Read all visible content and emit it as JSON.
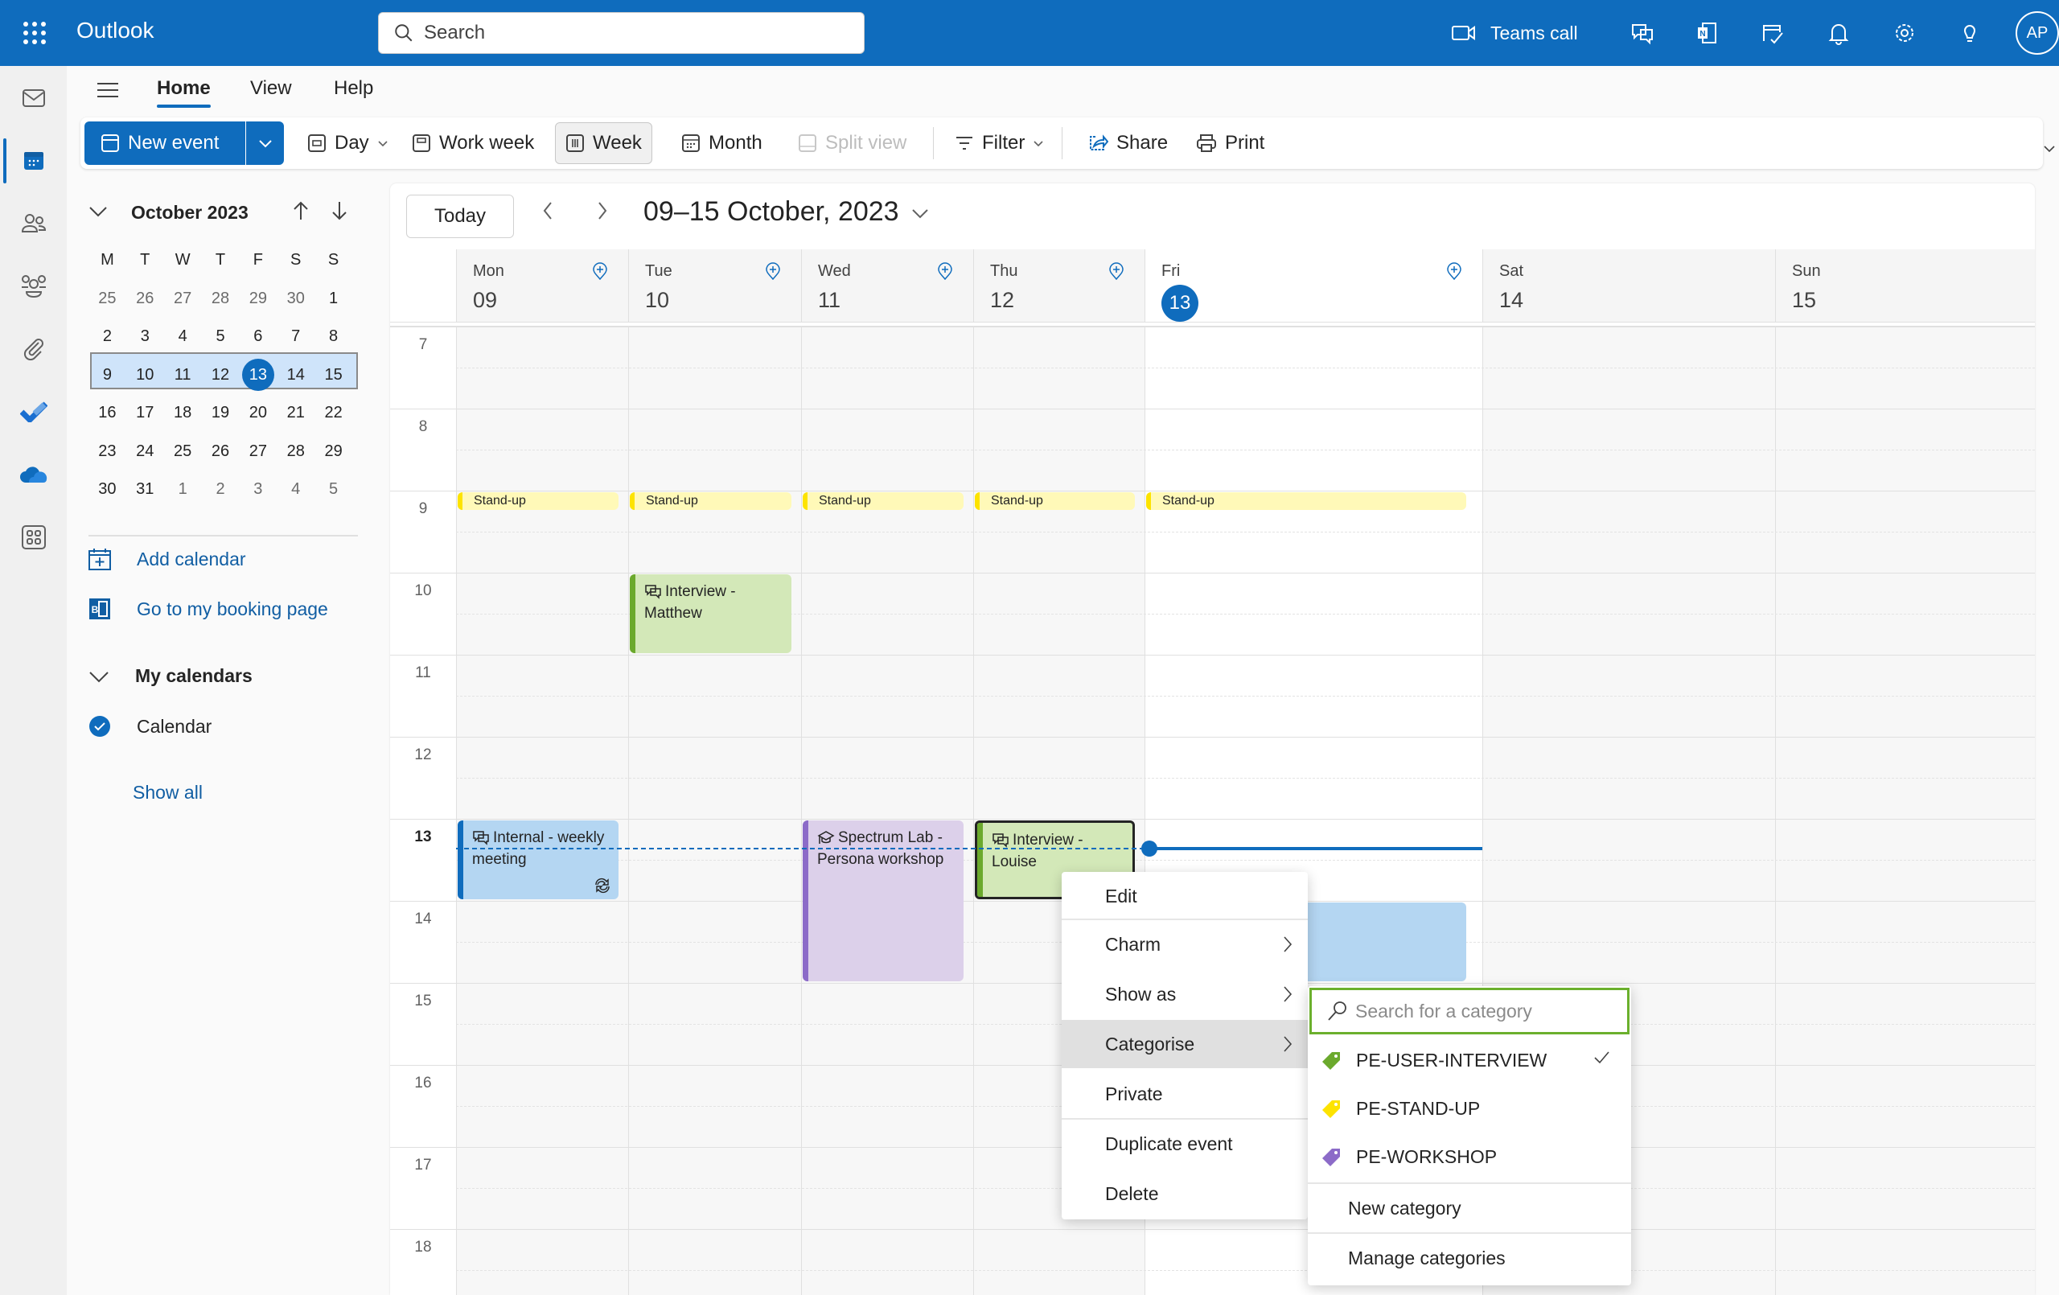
{
  "app": {
    "name": "Outlook"
  },
  "search": {
    "placeholder": "Search"
  },
  "topbar": {
    "teams_call_label": "Teams call",
    "avatar_initials": "AP",
    "icons": [
      "video-icon",
      "chat-feedback-icon",
      "onenote-icon",
      "todo-calendar-icon",
      "bell-icon",
      "gear-icon",
      "lightbulb-icon"
    ]
  },
  "rail": {
    "items": [
      "mail",
      "calendar",
      "people",
      "groups",
      "files",
      "todo",
      "onedrive",
      "more-apps"
    ],
    "active": "calendar"
  },
  "tabs": [
    {
      "label": "Home",
      "active": true
    },
    {
      "label": "View",
      "active": false
    },
    {
      "label": "Help",
      "active": false
    }
  ],
  "toolbar": {
    "new_event": "New event",
    "day": "Day",
    "work_week": "Work week",
    "week": "Week",
    "month": "Month",
    "split_view": "Split view",
    "filter": "Filter",
    "share": "Share",
    "print": "Print",
    "selected_view": "Week"
  },
  "minical": {
    "title": "October 2023",
    "weekdays": [
      "M",
      "T",
      "W",
      "T",
      "F",
      "S",
      "S"
    ],
    "weeks": [
      [
        {
          "d": "25",
          "m": true
        },
        {
          "d": "26",
          "m": true
        },
        {
          "d": "27",
          "m": true
        },
        {
          "d": "28",
          "m": true
        },
        {
          "d": "29",
          "m": true
        },
        {
          "d": "30",
          "m": true
        },
        {
          "d": "1"
        }
      ],
      [
        {
          "d": "2"
        },
        {
          "d": "3"
        },
        {
          "d": "4"
        },
        {
          "d": "5"
        },
        {
          "d": "6"
        },
        {
          "d": "7"
        },
        {
          "d": "8"
        }
      ],
      [
        {
          "d": "9"
        },
        {
          "d": "10"
        },
        {
          "d": "11"
        },
        {
          "d": "12"
        },
        {
          "d": "13",
          "today": true
        },
        {
          "d": "14"
        },
        {
          "d": "15"
        }
      ],
      [
        {
          "d": "16"
        },
        {
          "d": "17"
        },
        {
          "d": "18"
        },
        {
          "d": "19"
        },
        {
          "d": "20"
        },
        {
          "d": "21"
        },
        {
          "d": "22"
        }
      ],
      [
        {
          "d": "23"
        },
        {
          "d": "24"
        },
        {
          "d": "25"
        },
        {
          "d": "26"
        },
        {
          "d": "27"
        },
        {
          "d": "28"
        },
        {
          "d": "29"
        }
      ],
      [
        {
          "d": "30"
        },
        {
          "d": "31"
        },
        {
          "d": "1",
          "m": true
        },
        {
          "d": "2",
          "m": true
        },
        {
          "d": "3",
          "m": true
        },
        {
          "d": "4",
          "m": true
        },
        {
          "d": "5",
          "m": true
        }
      ]
    ],
    "selected_week_index": 2
  },
  "sidebar": {
    "add_calendar": "Add calendar",
    "booking_page": "Go to my booking page",
    "my_calendars": "My calendars",
    "calendar_item": "Calendar",
    "show_all": "Show all"
  },
  "calendar": {
    "today_label": "Today",
    "range_title": "09–15 October, 2023",
    "days": [
      {
        "name": "Mon",
        "num": "09",
        "today": false,
        "add": true
      },
      {
        "name": "Tue",
        "num": "10",
        "today": false,
        "add": true
      },
      {
        "name": "Wed",
        "num": "11",
        "today": false,
        "add": true
      },
      {
        "name": "Thu",
        "num": "12",
        "today": false,
        "add": true
      },
      {
        "name": "Fri",
        "num": "13",
        "today": true,
        "add": true
      },
      {
        "name": "Sat",
        "num": "14",
        "today": false,
        "add": false
      },
      {
        "name": "Sun",
        "num": "15",
        "today": false,
        "add": false
      }
    ],
    "hours": [
      "7",
      "8",
      "9",
      "10",
      "11",
      "12",
      "13",
      "14",
      "15",
      "16",
      "17",
      "18"
    ],
    "current_hour": "13",
    "events": [
      {
        "title": "Stand-up",
        "day": 0,
        "start": 9.0,
        "end": 9.25,
        "kind": "standup"
      },
      {
        "title": "Stand-up",
        "day": 1,
        "start": 9.0,
        "end": 9.25,
        "kind": "standup"
      },
      {
        "title": "Stand-up",
        "day": 2,
        "start": 9.0,
        "end": 9.25,
        "kind": "standup"
      },
      {
        "title": "Stand-up",
        "day": 3,
        "start": 9.0,
        "end": 9.25,
        "kind": "standup"
      },
      {
        "title": "Stand-up",
        "day": 4,
        "start": 9.0,
        "end": 9.25,
        "kind": "standup"
      },
      {
        "title": "Interview - Matthew",
        "day": 1,
        "start": 10.0,
        "end": 11.0,
        "kind": "interview",
        "icon": "chat-icon"
      },
      {
        "title": "Internal - weekly meeting",
        "day": 0,
        "start": 13.0,
        "end": 14.0,
        "kind": "internal",
        "icon": "chat-icon",
        "recurring": true
      },
      {
        "title": "Spectrum Lab - Persona workshop",
        "day": 2,
        "start": 13.0,
        "end": 15.0,
        "kind": "workshop",
        "icon": "mortarboard-icon"
      },
      {
        "title": "Interview - Louise",
        "day": 3,
        "start": 13.0,
        "end": 14.0,
        "kind": "interview",
        "icon": "chat-icon",
        "selected": true
      },
      {
        "title": "",
        "day": 4,
        "start": 14.0,
        "end": 15.0,
        "kind": "internal"
      }
    ],
    "now": 13.33
  },
  "colors": {
    "brand": "#0f6cbd",
    "standup_bg": "#fff9b8",
    "standup_bar": "#fde300",
    "interview_bg": "#d3e8b8",
    "interview_bar": "#6ba92d",
    "internal_bg": "#b4d6f2",
    "internal_bar": "#0f6cbd",
    "workshop_bg": "#dcd0ea",
    "workshop_bar": "#8c6bc8"
  },
  "context_menu": {
    "items": [
      {
        "label": "Edit",
        "submenu": false
      },
      {
        "label": "Charm",
        "submenu": true
      },
      {
        "label": "Show as",
        "submenu": true
      },
      {
        "label": "Categorise",
        "submenu": true,
        "highlighted": true
      },
      {
        "label": "Private",
        "submenu": false
      },
      {
        "label": "Duplicate event",
        "submenu": false
      },
      {
        "label": "Delete",
        "submenu": false
      }
    ]
  },
  "category_menu": {
    "search_placeholder": "Search for a category",
    "search_value": "",
    "categories": [
      {
        "label": "PE-USER-INTERVIEW",
        "color": "#6ba92d",
        "checked": true
      },
      {
        "label": "PE-STAND-UP",
        "color": "#fde300",
        "checked": false
      },
      {
        "label": "PE-WORKSHOP",
        "color": "#8c6bc8",
        "checked": false
      }
    ],
    "new_category": "New category",
    "manage_categories": "Manage categories"
  }
}
